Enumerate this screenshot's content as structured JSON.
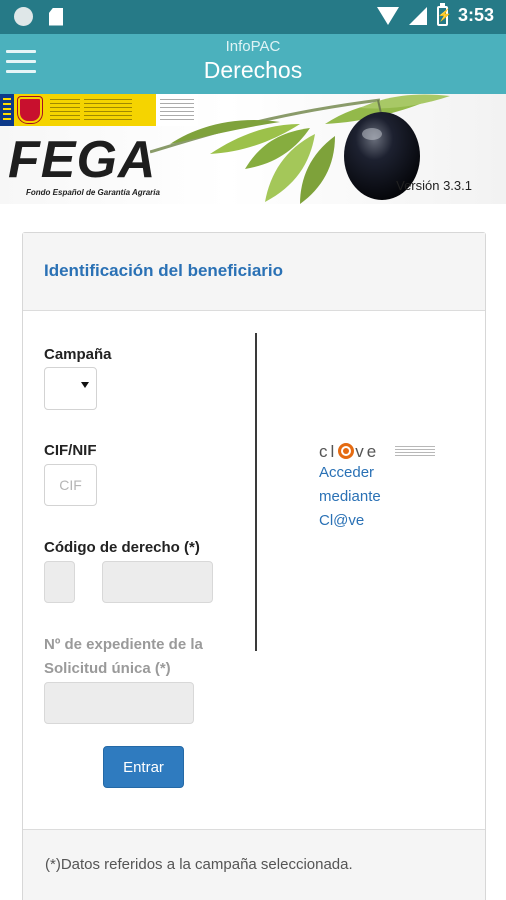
{
  "status_bar": {
    "time": "3:53",
    "icons": [
      "notification-circle-icon",
      "sd-card-icon",
      "wifi-icon",
      "signal-icon",
      "battery-charging-icon"
    ]
  },
  "app_bar": {
    "subtitle": "InfoPAC",
    "title": "Derechos",
    "menu_icon": "hamburger-menu-icon",
    "color": "#4bb1bd"
  },
  "banner": {
    "logo_text": "FEGA",
    "logo_tagline": "Fondo Español de Garantía Agraria",
    "version": "Versión 3.3.1"
  },
  "form": {
    "header": "Identificación del beneficiario",
    "campana_label": "Campaña",
    "campana_value": "",
    "cif_label": "CIF/NIF",
    "cif_placeholder": "CIF",
    "codigo_label": "Código de derecho (*)",
    "expediente_label": "Nº de expediente de la Solicitud única (*)",
    "submit_label": "Entrar",
    "footer_note": "(*)Datos referidos a la campaña seleccionada."
  },
  "clave": {
    "logo_prefix": "cl",
    "logo_suffix": "ve",
    "link_text": "Acceder mediante Cl@ve"
  },
  "colors": {
    "status_bar": "#267a87",
    "accent": "#2a71b5",
    "button": "#2f7bbf",
    "clave_orange": "#e56b12"
  }
}
